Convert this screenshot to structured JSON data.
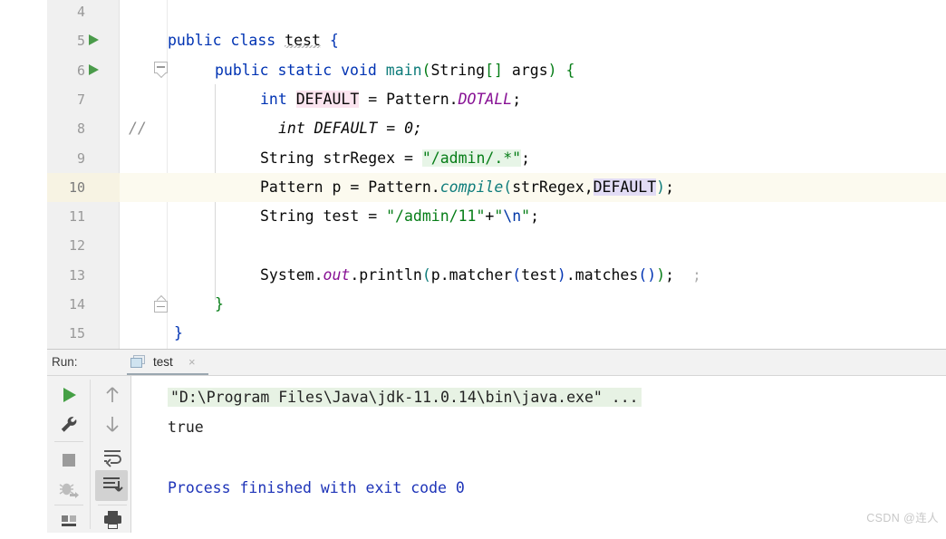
{
  "editor": {
    "gutter_lines": [
      "4",
      "5",
      "6",
      "7",
      "8",
      "9",
      "10",
      "11",
      "12",
      "13",
      "14",
      "15"
    ],
    "run_markers": [
      "5",
      "6"
    ],
    "highlighted_line": "10",
    "comment_marker": "//",
    "lines": [
      {
        "num": "4",
        "text": ""
      },
      {
        "num": "5",
        "text": "public class test {"
      },
      {
        "num": "6",
        "text": "    public static void main(String[] args) {"
      },
      {
        "num": "7",
        "text": "        int DEFAULT = Pattern.DOTALL;"
      },
      {
        "num": "8",
        "text": "          int DEFAULT = 0;"
      },
      {
        "num": "9",
        "text": "        String strRegex = \"/admin/.*\";"
      },
      {
        "num": "10",
        "text": "        Pattern p = Pattern.compile(strRegex,DEFAULT);"
      },
      {
        "num": "11",
        "text": "        String test = \"/admin/11\"+\"\\n\";"
      },
      {
        "num": "12",
        "text": ""
      },
      {
        "num": "13",
        "text": "        System.out.println(p.matcher(test).matches());  ;"
      },
      {
        "num": "14",
        "text": "    }"
      },
      {
        "num": "15",
        "text": "}"
      }
    ],
    "tokens": {
      "kw_public": "public",
      "kw_class": "class",
      "kw_static": "static",
      "kw_void": "void",
      "kw_int": "int",
      "type_string": "String",
      "type_pattern": "Pattern",
      "name_test": "test",
      "name_main": "main",
      "name_args": "args",
      "name_default": "DEFAULT",
      "name_dotall": "DOTALL",
      "name_strregex": "strRegex",
      "name_compile": "compile",
      "name_p": "p",
      "name_system": "System",
      "name_out": "out",
      "name_println": "println",
      "name_matcher": "matcher",
      "name_matches": "matches",
      "str_regex": "\"/admin/.*\"",
      "str_admin11": "\"/admin/11\"",
      "str_newline_quote_open": "\"",
      "str_newline_esc": "\\n",
      "str_newline_quote_close": "\"",
      "comment_text": "int DEFAULT = 0;",
      "zero": "0"
    }
  },
  "run_panel": {
    "label": "Run:",
    "tab_name": "test",
    "tab_close": "×",
    "toolbar_left": [
      {
        "name": "rerun",
        "glyph": "run-triangle"
      },
      {
        "name": "settings",
        "glyph": "wrench"
      },
      {
        "name": "stop",
        "glyph": "square"
      },
      {
        "name": "debug-attach",
        "glyph": "bug-arrow"
      },
      {
        "name": "console",
        "glyph": "console-bars"
      }
    ],
    "toolbar_right": [
      {
        "name": "up",
        "glyph": "arrow-up"
      },
      {
        "name": "down",
        "glyph": "arrow-down"
      },
      {
        "name": "soft-wrap",
        "glyph": "wrap-arrow"
      },
      {
        "name": "scroll-to-end",
        "glyph": "scroll-end"
      },
      {
        "name": "print",
        "glyph": "printer"
      }
    ],
    "active_tool": "scroll-to-end",
    "console": {
      "command": "\"D:\\Program Files\\Java\\jdk-11.0.14\\bin\\java.exe\" ...",
      "output": "true",
      "finished": "Process finished with exit code 0"
    }
  },
  "watermark": "CSDN @连人",
  "colors": {
    "keyword": "#0033b3",
    "string": "#067d17",
    "static_field": "#871094",
    "class_name": "#0e7c7b",
    "comment": "#8c8c8c",
    "highlight_line": "#fcfaef",
    "highlight_pink": "#fbe4ef",
    "highlight_lavender": "#e2dcf5",
    "console_command_bg": "#e7f2e4",
    "console_finished": "#1d33b8",
    "run_marker_green": "#4a9b4a"
  }
}
